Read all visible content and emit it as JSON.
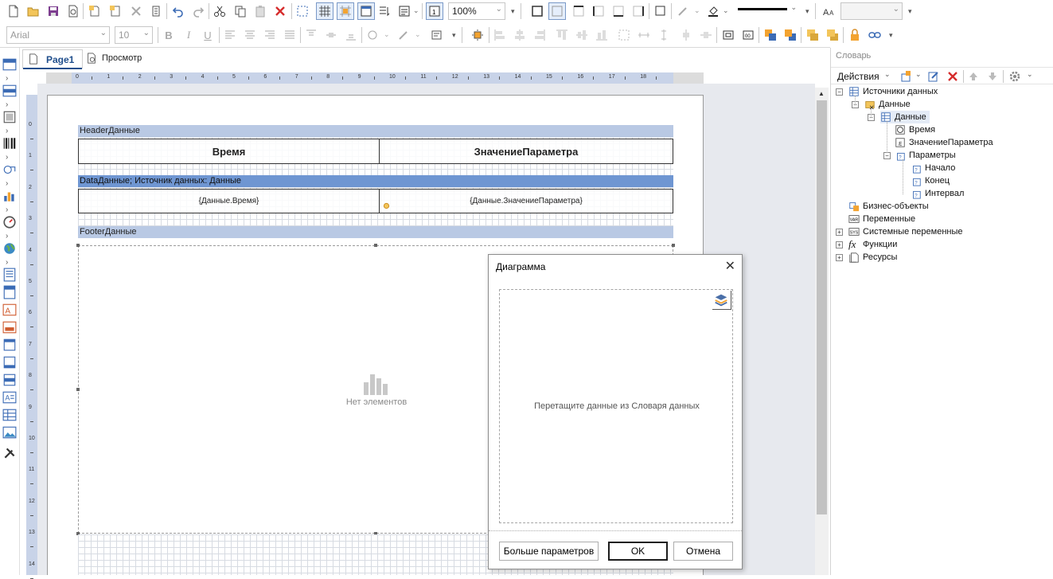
{
  "toolbar": {
    "font_name": "Arial",
    "font_size": "10",
    "zoom": "100%"
  },
  "tabs": [
    {
      "label": "Page1"
    },
    {
      "label": "Просмотр"
    }
  ],
  "ruler": {
    "h_numbers": [
      "0",
      "1",
      "2",
      "3",
      "4",
      "5",
      "6",
      "7",
      "8",
      "9",
      "10",
      "11",
      "12",
      "13",
      "14",
      "15",
      "16",
      "17",
      "18"
    ],
    "v_numbers": [
      "0",
      "1",
      "2",
      "3",
      "4",
      "5",
      "6",
      "7",
      "8",
      "9",
      "10",
      "11",
      "12",
      "13",
      "14"
    ]
  },
  "report": {
    "header_band": "HeaderДанные",
    "col1_header": "Время",
    "col2_header": "ЗначениеПараметра",
    "data_band": "DataДанные; Источник данных: Данные",
    "col1_value": "{Данные.Время}",
    "col2_value": "{Данные.ЗначениеПараметра}",
    "footer_band": "FooterДанные",
    "chart_empty": "Нет элементов"
  },
  "dictionary": {
    "title": "Словарь",
    "actions_label": "Действия",
    "tree": [
      {
        "label": "Источники данных"
      },
      {
        "label": "Данные"
      },
      {
        "label": "Данные"
      },
      {
        "label": "Время"
      },
      {
        "label": "ЗначениеПараметра"
      },
      {
        "label": "Параметры"
      },
      {
        "label": "Начало"
      },
      {
        "label": "Конец"
      },
      {
        "label": "Интервал"
      },
      {
        "label": "Бизнес-объекты"
      },
      {
        "label": "Переменные"
      },
      {
        "label": "Системные переменные"
      },
      {
        "label": "Функции"
      },
      {
        "label": "Ресурсы"
      }
    ]
  },
  "dialog": {
    "title": "Диаграмма",
    "hint": "Перетащите данные из Словаря данных",
    "more_button": "Больше параметров",
    "ok_button": "OK",
    "cancel_button": "Отмена"
  },
  "colors": {
    "band_header": "#b9c9e4",
    "band_data": "#6f96d2",
    "ruler": "#c8d3e8",
    "canvas": "#e7e9ee"
  }
}
